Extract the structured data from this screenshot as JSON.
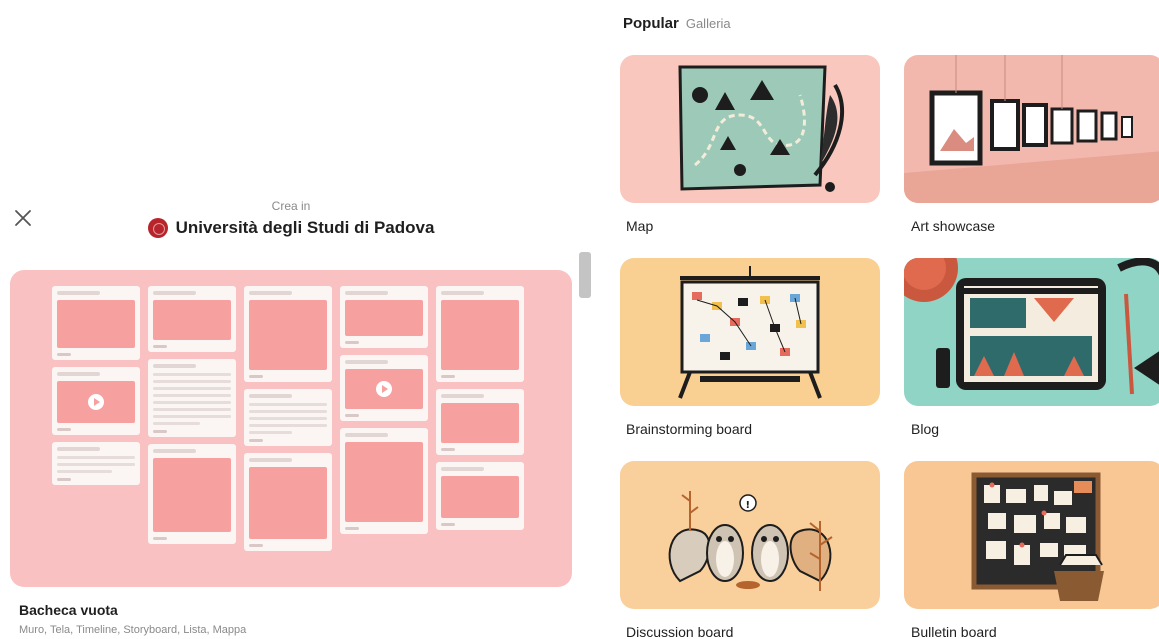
{
  "header": {
    "crea_label": "Crea in",
    "org_name": "Università degli Studi di Padova"
  },
  "blank_board": {
    "title": "Bacheca vuota",
    "subtitle": "Muro, Tela, Timeline, Storyboard, Lista, Mappa"
  },
  "popular": {
    "title": "Popular",
    "gallery_link": "Galleria",
    "templates": [
      {
        "label": "Map",
        "illustration": "treasure-map-illustration",
        "bg": "#f9c7bd"
      },
      {
        "label": "Art showcase",
        "illustration": "art-gallery-illustration",
        "bg": "#f3b8ad"
      },
      {
        "label": "Brainstorming board",
        "illustration": "brainstorm-board-illustration",
        "bg": "#f9cf92"
      },
      {
        "label": "Blog",
        "illustration": "blog-desk-illustration",
        "bg": "#8fd4c4"
      },
      {
        "label": "Discussion board",
        "illustration": "squirrels-illustration",
        "bg": "#f9cf9c"
      },
      {
        "label": "Bulletin board",
        "illustration": "corkboard-illustration",
        "bg": "#f9c794"
      }
    ]
  },
  "colors": {
    "blank_card_bg": "#f9c1c1",
    "post_image": "#f6a0a0",
    "org_logo": "#b8242b"
  }
}
